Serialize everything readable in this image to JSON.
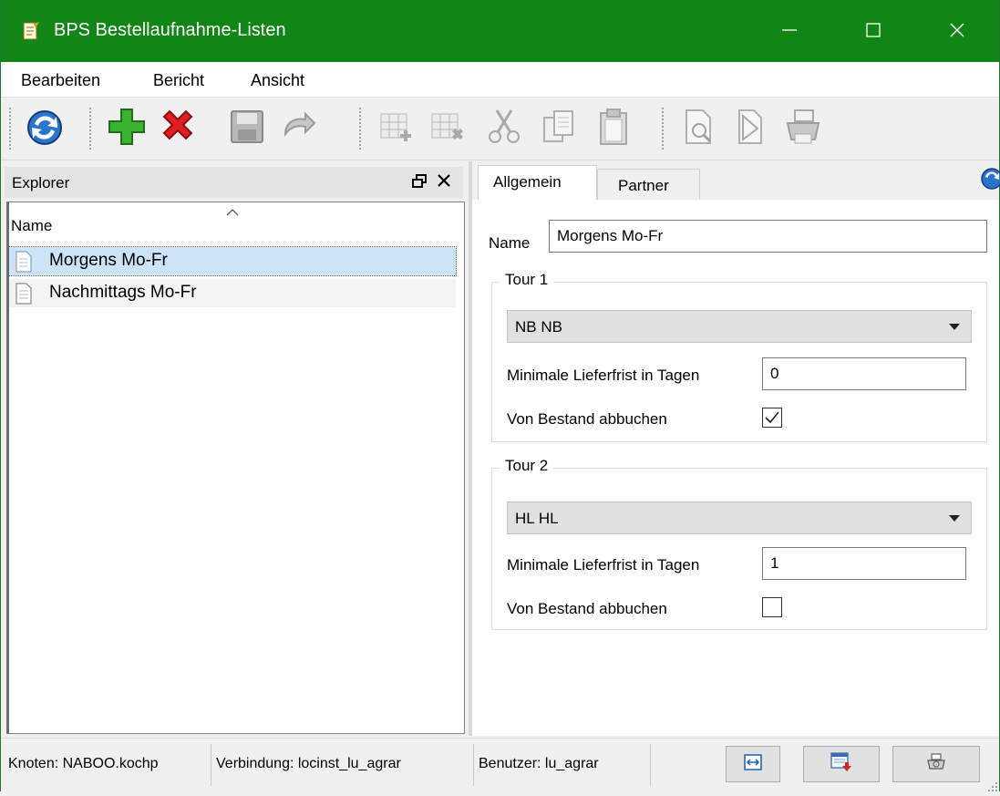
{
  "window": {
    "title": "BPS Bestellaufnahme-Listen",
    "accent_color": "#118515",
    "controls": [
      "minimize-icon",
      "maximize-icon",
      "close-icon"
    ]
  },
  "menu": {
    "items": [
      "Bearbeiten",
      "Bericht",
      "Ansicht"
    ]
  },
  "toolbar": {
    "icons": [
      "refresh-icon",
      "add-icon",
      "delete-icon",
      "save-icon",
      "undo-icon",
      "grid-add-icon",
      "grid-remove-icon",
      "cut-icon",
      "copy-icon",
      "paste-icon",
      "preview-icon",
      "pdf-icon",
      "print-icon"
    ]
  },
  "explorer": {
    "title": "Explorer",
    "column": "Name",
    "items": [
      {
        "label": "Morgens Mo-Fr",
        "selected": true
      },
      {
        "label": "Nachmittags Mo-Fr",
        "selected": false
      }
    ]
  },
  "detail": {
    "tabs": [
      "Allgemein",
      "Partner"
    ],
    "active_tab": "Allgemein",
    "name_label": "Name",
    "name_value": "Morgens Mo-Fr",
    "tours": [
      {
        "title": "Tour 1",
        "combo_value": "NB NB",
        "lead_label": "Minimale Lieferfrist in Tagen",
        "lead_value": "0",
        "stock_label": "Von Bestand abbuchen",
        "stock_checked": true
      },
      {
        "title": "Tour 2",
        "combo_value": "HL HL",
        "lead_label": "Minimale Lieferfrist in Tagen",
        "lead_value": "1",
        "stock_label": "Von Bestand abbuchen",
        "stock_checked": false
      }
    ]
  },
  "status": {
    "node": "Knoten: NABOO.kochp",
    "connection": "Verbindung: locinst_lu_agrar",
    "user": "Benutzer: lu_agrar"
  }
}
